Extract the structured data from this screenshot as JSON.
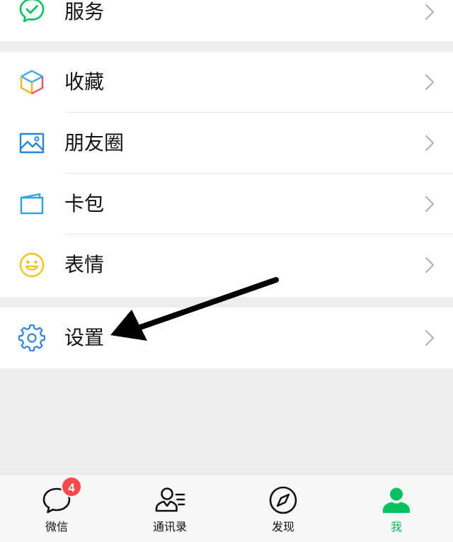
{
  "menu": {
    "services": {
      "label": "服务",
      "icon": "services-check-icon"
    },
    "favorites": {
      "label": "收藏",
      "icon": "favorites-cube-icon"
    },
    "moments": {
      "label": "朋友圈",
      "icon": "moments-picture-icon"
    },
    "cards": {
      "label": "卡包",
      "icon": "cards-wallet-icon"
    },
    "stickers": {
      "label": "表情",
      "icon": "stickers-smile-icon"
    },
    "settings": {
      "label": "设置",
      "icon": "settings-gear-icon"
    }
  },
  "tabbar": {
    "chats": {
      "label": "微信",
      "badge": "4"
    },
    "contacts": {
      "label": "通讯录"
    },
    "discover": {
      "label": "发现"
    },
    "me": {
      "label": "我"
    }
  },
  "colors": {
    "accent": "#07c160",
    "badge": "#f64b4b",
    "background": "#ededed",
    "chevron": "#b3b3b3"
  }
}
